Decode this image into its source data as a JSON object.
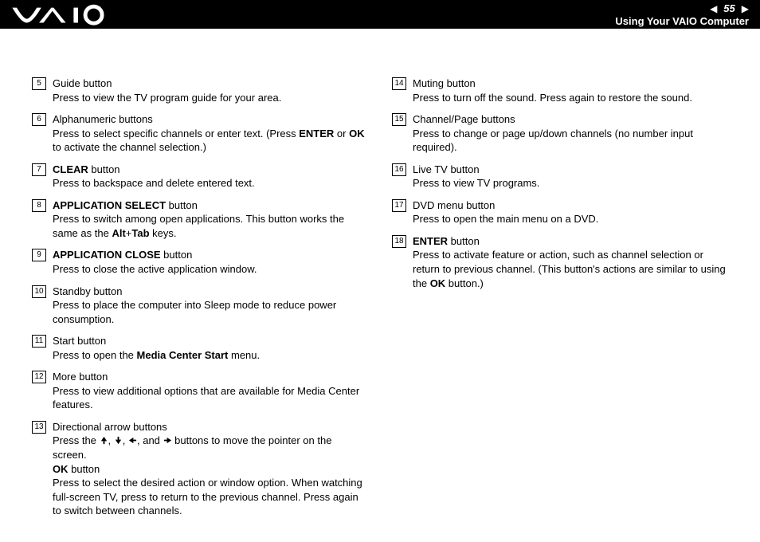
{
  "page_number": "55",
  "section_title": "Using Your VAIO Computer",
  "left_items": [
    {
      "num": "5",
      "title_parts": [
        {
          "text": "Guide button",
          "bold": false
        }
      ],
      "body": "Press to view the TV program guide for your area."
    },
    {
      "num": "6",
      "title_parts": [
        {
          "text": "Alphanumeric buttons",
          "bold": false
        }
      ],
      "body_parts": [
        "Press to select specific channels or enter text. (Press ",
        {
          "bold": "ENTER"
        },
        " or ",
        {
          "bold": "OK"
        },
        " to activate the channel selection.)"
      ]
    },
    {
      "num": "7",
      "title_parts": [
        {
          "text": "CLEAR",
          "bold": true
        },
        {
          "text": " button",
          "bold": false
        }
      ],
      "body": "Press to backspace and delete entered text."
    },
    {
      "num": "8",
      "title_parts": [
        {
          "text": "APPLICATION SELECT",
          "bold": true
        },
        {
          "text": " button",
          "bold": false
        }
      ],
      "body_parts": [
        "Press to switch among open applications. This button works the same as the ",
        {
          "bold": "Alt"
        },
        "+",
        {
          "bold": "Tab"
        },
        " keys."
      ]
    },
    {
      "num": "9",
      "title_parts": [
        {
          "text": "APPLICATION CLOSE",
          "bold": true
        },
        {
          "text": " button",
          "bold": false
        }
      ],
      "body": "Press to close the active application window."
    },
    {
      "num": "10",
      "title_parts": [
        {
          "text": "Standby button",
          "bold": false
        }
      ],
      "body": "Press to place the computer into Sleep mode to reduce power consumption."
    },
    {
      "num": "11",
      "title_parts": [
        {
          "text": "Start button",
          "bold": false
        }
      ],
      "body_parts": [
        "Press to open the ",
        {
          "bold": "Media Center Start"
        },
        " menu."
      ]
    },
    {
      "num": "12",
      "title_parts": [
        {
          "text": "More button",
          "bold": false
        }
      ],
      "body": "Press to view additional options that are available for Media Center features."
    },
    {
      "num": "13",
      "title_parts": [
        {
          "text": "Directional arrow buttons",
          "bold": false
        }
      ],
      "body_parts": [
        "Press the ",
        {
          "arrow": "up"
        },
        ", ",
        {
          "arrow": "down"
        },
        ", ",
        {
          "arrow": "left"
        },
        ", and ",
        {
          "arrow": "right"
        },
        " buttons to move the pointer on the screen.",
        {
          "br": true
        },
        {
          "bold": "OK"
        },
        " button",
        {
          "br": true
        },
        "Press to select the desired action or window option. When watching full-screen TV, press to return to the previous channel. Press again to switch between channels."
      ]
    }
  ],
  "right_items": [
    {
      "num": "14",
      "title_parts": [
        {
          "text": "Muting button",
          "bold": false
        }
      ],
      "body": "Press to turn off the sound. Press again to restore the sound."
    },
    {
      "num": "15",
      "title_parts": [
        {
          "text": "Channel/Page buttons",
          "bold": false
        }
      ],
      "body": "Press to change or page up/down channels (no number input required)."
    },
    {
      "num": "16",
      "title_parts": [
        {
          "text": "Live TV button",
          "bold": false
        }
      ],
      "body": "Press to view TV programs."
    },
    {
      "num": "17",
      "title_parts": [
        {
          "text": "DVD menu button",
          "bold": false
        }
      ],
      "body": "Press to open the main menu on a DVD."
    },
    {
      "num": "18",
      "title_parts": [
        {
          "text": "ENTER",
          "bold": true
        },
        {
          "text": " button",
          "bold": false
        }
      ],
      "body_parts": [
        "Press to activate feature or action, such as channel selection or return to previous channel. (This button's actions are similar to using the ",
        {
          "bold": "OK"
        },
        " button.)"
      ]
    }
  ]
}
